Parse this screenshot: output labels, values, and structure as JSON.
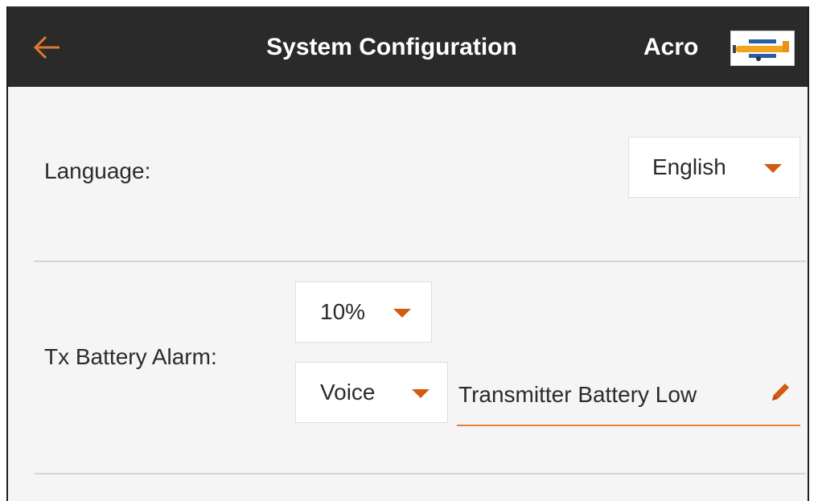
{
  "header": {
    "back_icon": "back-arrow-icon",
    "title": "System Configuration",
    "model_name": "Acro",
    "model_thumbnail_icon": "airplane-thumbnail-icon"
  },
  "language": {
    "label": "Language:",
    "selected": "English"
  },
  "tx_battery_alarm": {
    "label": "Tx Battery Alarm:",
    "threshold_selected": "10%",
    "alert_type_selected": "Voice",
    "alert_text": "Transmitter Battery Low",
    "edit_icon": "pencil-icon"
  },
  "colors": {
    "header_bg": "#2a2a2a",
    "accent": "#d35a10",
    "underline": "#e67e3c",
    "content_bg": "#f5f5f5"
  }
}
